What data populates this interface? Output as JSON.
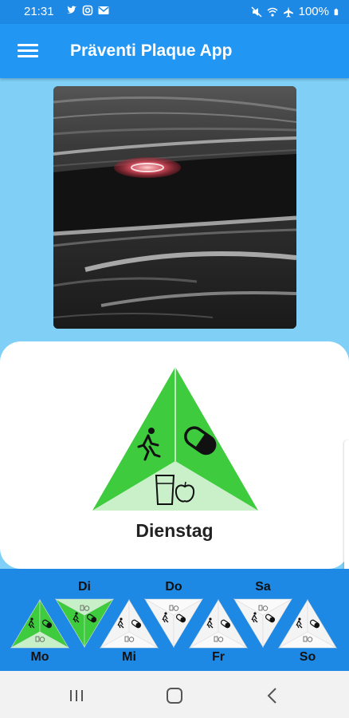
{
  "status": {
    "time": "21:31",
    "battery": "100%"
  },
  "header": {
    "title": "Präventi Plaque App"
  },
  "card": {
    "day": "Dienstag"
  },
  "week": [
    {
      "label": "Mo",
      "state": "done"
    },
    {
      "label": "Di",
      "state": "done"
    },
    {
      "label": "Mi",
      "state": "open"
    },
    {
      "label": "Do",
      "state": "open"
    },
    {
      "label": "Fr",
      "state": "open"
    },
    {
      "label": "Sa",
      "state": "open"
    },
    {
      "label": "So",
      "state": "open"
    }
  ],
  "colors": {
    "appbar": "#2196f3",
    "statusbar": "#1e88e5",
    "background": "#7fcff7",
    "green": "#3ecb3e",
    "light_green": "#c8f0c8",
    "white_tri": "#f4f4f4"
  }
}
